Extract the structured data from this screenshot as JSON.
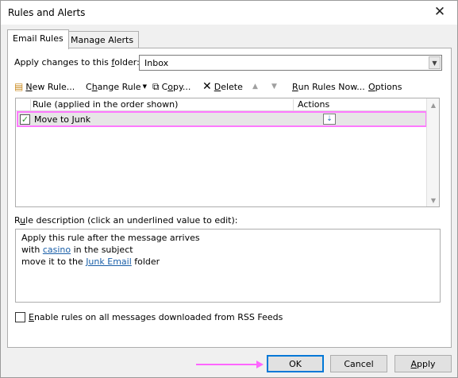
{
  "window": {
    "title": "Rules and Alerts"
  },
  "tabs": [
    {
      "label": "Email Rules"
    },
    {
      "label": "Manage Alerts"
    }
  ],
  "folder": {
    "label_pre": "Apply changes to this ",
    "label_u": "f",
    "label_post": "older:",
    "value": "Inbox"
  },
  "toolbar": {
    "new_rule_u": "N",
    "new_rule_rest": "ew Rule...",
    "change_rule_u": "h",
    "change_rule_pre": "C",
    "change_rule_rest": "ange Rule",
    "copy_u": "o",
    "copy_pre": "C",
    "copy_rest": "py...",
    "delete_u": "D",
    "delete_rest": "elete",
    "run_u": "R",
    "run_rest": "un Rules Now...",
    "options_u": "O",
    "options_rest": "ptions"
  },
  "rules_table": {
    "columns": [
      "Rule (applied in the order shown)",
      "Actions"
    ],
    "rows": [
      {
        "enabled": true,
        "name": "Move to Junk",
        "action_icon": "move-to-folder-icon"
      }
    ]
  },
  "description": {
    "label_pre": "R",
    "label_u": "u",
    "label_post": "le description (click an underlined value to edit):",
    "line1": "Apply this rule after the message arrives",
    "line2_pre": "with ",
    "line2_link": "casino",
    "line2_post": " in the subject",
    "line3_pre": "move it to the ",
    "line3_link": "Junk Email",
    "line3_post": " folder"
  },
  "rss": {
    "checked": false,
    "label_u": "E",
    "label_rest": "nable rules on all messages downloaded from RSS Feeds"
  },
  "buttons": {
    "ok": "OK",
    "cancel": "Cancel",
    "apply_u": "A",
    "apply_rest": "pply"
  },
  "colors": {
    "highlight": "#ff7aff",
    "link": "#1a5fa8",
    "default_button_border": "#0078d7"
  }
}
